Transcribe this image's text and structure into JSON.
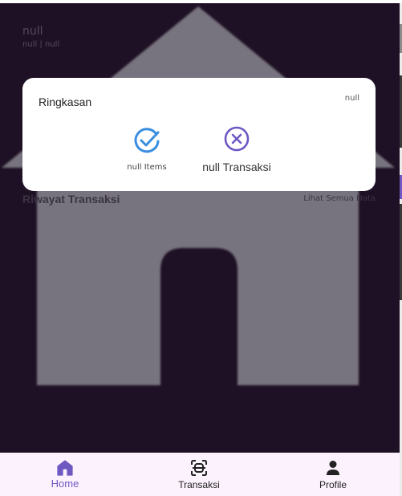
{
  "header": {
    "name": "null",
    "subtitle": "null | null"
  },
  "summary": {
    "title": "Ringkasan",
    "date": "null",
    "items_label": "null Items",
    "transactions_label": "null Transaksi",
    "items_icon": "check-circle-icon",
    "transactions_icon": "x-circle-icon"
  },
  "history": {
    "title": "Riwayat Transaksi",
    "see_all": "Lihat Semua Data"
  },
  "bottom_nav": {
    "items": [
      {
        "label": "Home",
        "icon": "home-icon",
        "active": true
      },
      {
        "label": "Transaksi",
        "icon": "scan-icon",
        "active": false
      },
      {
        "label": "Profile",
        "icon": "person-icon",
        "active": false
      }
    ]
  },
  "colors": {
    "background": "#1f1125",
    "card": "#ffffff",
    "accent": "#6e58c2",
    "check": "#3a8ee0",
    "cross": "#6e58c2",
    "nav_background": "#fcf2fd"
  }
}
